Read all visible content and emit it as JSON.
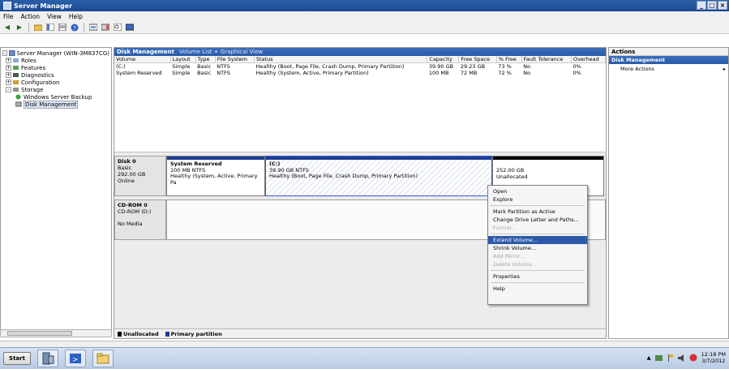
{
  "window": {
    "title": "Server Manager",
    "controls": [
      "_",
      "□",
      "×"
    ]
  },
  "menu": [
    "File",
    "Action",
    "View",
    "Help"
  ],
  "toolbar_icons": [
    "back-icon",
    "forward-icon",
    "up-icon",
    "show-hide-tree-icon",
    "properties-icon",
    "help-icon",
    "refresh-icon",
    "settings-icon",
    "search-icon",
    "disk-icon"
  ],
  "tree": [
    {
      "label": "Server Manager (WIN-3M837CG)",
      "indent": 0,
      "exp": "-"
    },
    {
      "label": "Roles",
      "indent": 1,
      "exp": "+"
    },
    {
      "label": "Features",
      "indent": 1,
      "exp": "+"
    },
    {
      "label": "Diagnostics",
      "indent": 1,
      "exp": "+"
    },
    {
      "label": "Configuration",
      "indent": 1,
      "exp": "+"
    },
    {
      "label": "Storage",
      "indent": 1,
      "exp": "-"
    },
    {
      "label": "Windows Server Backup",
      "indent": 2,
      "exp": ""
    },
    {
      "label": "Disk Management",
      "indent": 2,
      "exp": "",
      "selected": true
    }
  ],
  "center": {
    "header": "Disk Management",
    "subheader": "Volume List + Graphical View",
    "columns": [
      "Volume",
      "Layout",
      "Type",
      "File System",
      "Status",
      "Capacity",
      "Free Space",
      "% Free",
      "Fault Tolerance",
      "Overhead"
    ],
    "rows": [
      [
        "(C:)",
        "Simple",
        "Basic",
        "NTFS",
        "Healthy (Boot, Page File, Crash Dump, Primary Partition)",
        "39.90 GB",
        "29.23 GB",
        "73 %",
        "No",
        "0%"
      ],
      [
        "System Reserved",
        "Simple",
        "Basic",
        "NTFS",
        "Healthy (System, Active, Primary Partition)",
        "100 MB",
        "72 MB",
        "72 %",
        "No",
        "0%"
      ]
    ],
    "disk0": {
      "label": "Disk 0",
      "type": "Basic",
      "size": "292.00 GB",
      "status": "Online",
      "partitions": [
        {
          "name": "System Reserved",
          "size": "100 MB NTFS",
          "status": "Healthy (System, Active, Primary Pa"
        },
        {
          "name": "(C:)",
          "size": "39.90 GB NTFS",
          "status": "Healthy (Boot, Page File, Crash Dump, Primary Partition)"
        },
        {
          "name": "",
          "size": "252.00 GB",
          "status": "Unallocated"
        }
      ]
    },
    "cdrom": {
      "label": "CD-ROM 0",
      "type": "CD-ROM (D:)",
      "media": "No Media"
    },
    "legend": [
      {
        "label": "Unallocated",
        "color": "#000000"
      },
      {
        "label": "Primary partition",
        "color": "#1c3d95"
      }
    ]
  },
  "context_menu": [
    {
      "label": "Open",
      "disabled": false
    },
    {
      "label": "Explore",
      "disabled": false
    },
    {
      "sep": true
    },
    {
      "label": "Mark Partition as Active",
      "disabled": false
    },
    {
      "label": "Change Drive Letter and Paths...",
      "disabled": false
    },
    {
      "label": "Format...",
      "disabled": true
    },
    {
      "sep": true
    },
    {
      "label": "Extend Volume...",
      "disabled": false,
      "highlighted": true
    },
    {
      "label": "Shrink Volume...",
      "disabled": false
    },
    {
      "label": "Add Mirror...",
      "disabled": true
    },
    {
      "label": "Delete Volume...",
      "disabled": true
    },
    {
      "sep": true
    },
    {
      "label": "Properties",
      "disabled": false
    },
    {
      "sep": true
    },
    {
      "label": "Help",
      "disabled": false
    }
  ],
  "actions": {
    "title": "Actions",
    "group": "Disk Management",
    "items": [
      {
        "label": "More Actions"
      }
    ]
  },
  "taskbar": {
    "start": "Start",
    "clock_time": "12:18 PM",
    "clock_date": "3/7/2012"
  }
}
